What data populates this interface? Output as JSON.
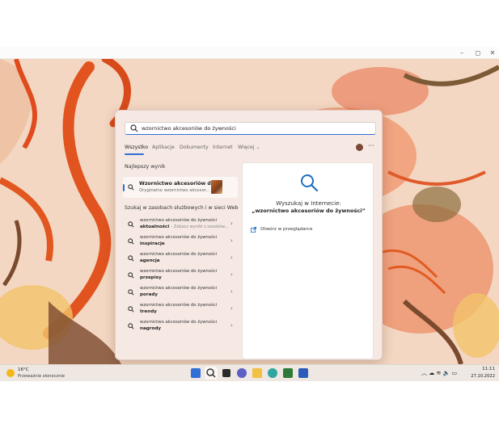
{
  "window": {
    "minimize": "–",
    "maximize": "◻",
    "close": "✕"
  },
  "search": {
    "query": "wzornictwo akcesoriów do żywności",
    "tabs": [
      "Wszystko",
      "Aplikacje",
      "Dokumenty",
      "Internet",
      "Więcej ⌄"
    ],
    "more": "···"
  },
  "best_match": {
    "heading": "Najlepszy wynik",
    "title": "Wzornictwo akcesoriów d...",
    "subtitle": "Oryginalne wzornictwo akcesor..."
  },
  "web_section": {
    "heading": "Szukaj w zasobach służbowych i w sieci Web",
    "results": [
      {
        "line1": "wzornictwo akcesoriów do żywności",
        "line2": "aktualności",
        "hint": " – Zobacz wyniki z zasobów..."
      },
      {
        "line1": "wzornictwo akcesoriów do żywności",
        "line2": "inspiracje",
        "hint": ""
      },
      {
        "line1": "wzornictwo akcesoriów do żywności",
        "line2": "agencja",
        "hint": ""
      },
      {
        "line1": "wzornictwo akcesoriów do żywności",
        "line2": "przepisy",
        "hint": ""
      },
      {
        "line1": "wzornictwo akcesoriów do żywności",
        "line2": "porady",
        "hint": ""
      },
      {
        "line1": "wzornictwo akcesoriów do żywności",
        "line2": "trendy",
        "hint": ""
      },
      {
        "line1": "wzornictwo akcesoriów do żywności",
        "line2": "nagrody",
        "hint": ""
      }
    ]
  },
  "preview": {
    "title": "Wyszukaj w Internecie:",
    "query": "„wzornictwo akcesoriów do żywności”",
    "open_browser": "Otwórz w przeglądarce"
  },
  "taskbar": {
    "weather_temp": "16°C",
    "weather_desc": "Przeważnie słonecznie",
    "tray": "︿  ☁  ≋  🔈  ▭",
    "time": "11:11",
    "date": "27.10.2022"
  },
  "colors": {
    "accent": "#2f6fd6",
    "wallpaper": "#f3d7c2",
    "panel": "#f6e9e4"
  }
}
